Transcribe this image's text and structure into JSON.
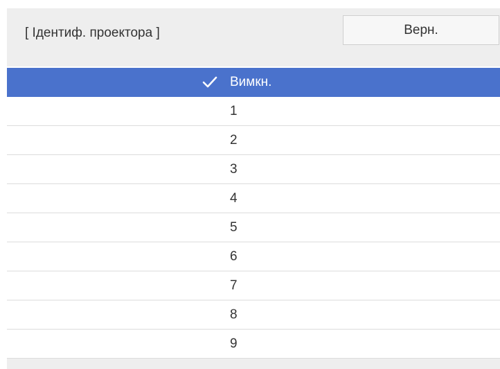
{
  "header": {
    "title": "[ Ідентиф. проектора ]",
    "back_label": "Верн."
  },
  "options": {
    "selected_index": 0,
    "check_icon": "checkmark-icon",
    "items": [
      {
        "label": "Вимкн."
      },
      {
        "label": "1"
      },
      {
        "label": "2"
      },
      {
        "label": "3"
      },
      {
        "label": "4"
      },
      {
        "label": "5"
      },
      {
        "label": "6"
      },
      {
        "label": "7"
      },
      {
        "label": "8"
      },
      {
        "label": "9"
      }
    ]
  },
  "colors": {
    "selected_background": "#4a72cc",
    "header_background": "#eeeeee",
    "text": "#333333"
  }
}
